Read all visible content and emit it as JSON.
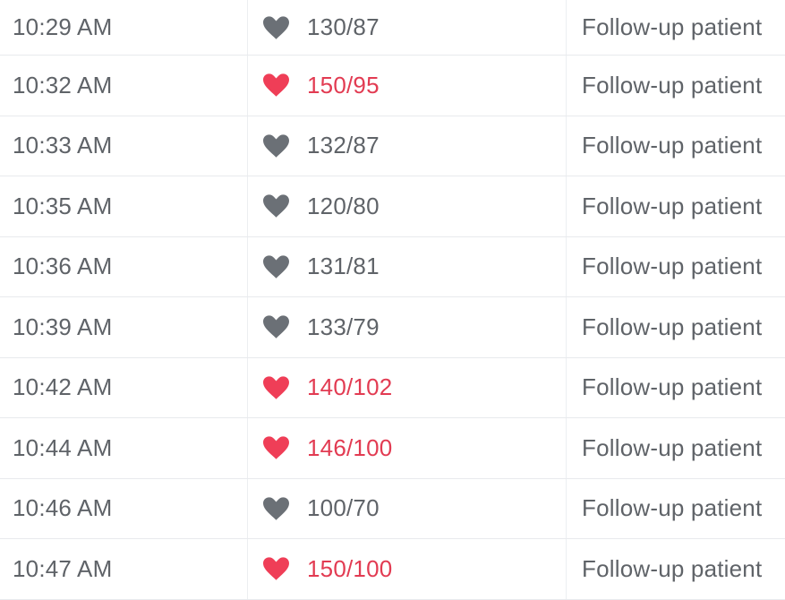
{
  "colors": {
    "text": "#5f6368",
    "alert": "#e23b52",
    "heart_normal": "#6b7076",
    "heart_alert": "#ef3e57",
    "divider": "#e8eaed"
  },
  "rows": [
    {
      "time": "10:29 AM",
      "bp": "130/87",
      "status": "normal",
      "icon": "heart-icon",
      "note": "Follow-up patient"
    },
    {
      "time": "10:32 AM",
      "bp": "150/95",
      "status": "alert",
      "icon": "heart-icon",
      "note": "Follow-up patient"
    },
    {
      "time": "10:33 AM",
      "bp": "132/87",
      "status": "normal",
      "icon": "heart-icon",
      "note": "Follow-up patient"
    },
    {
      "time": "10:35 AM",
      "bp": "120/80",
      "status": "normal",
      "icon": "heart-icon",
      "note": "Follow-up patient"
    },
    {
      "time": "10:36 AM",
      "bp": "131/81",
      "status": "normal",
      "icon": "heart-icon",
      "note": "Follow-up patient"
    },
    {
      "time": "10:39 AM",
      "bp": "133/79",
      "status": "normal",
      "icon": "heart-icon",
      "note": "Follow-up patient"
    },
    {
      "time": "10:42 AM",
      "bp": "140/102",
      "status": "alert",
      "icon": "heart-icon",
      "note": "Follow-up patient"
    },
    {
      "time": "10:44 AM",
      "bp": "146/100",
      "status": "alert",
      "icon": "heart-icon",
      "note": "Follow-up patient"
    },
    {
      "time": "10:46 AM",
      "bp": "100/70",
      "status": "normal",
      "icon": "heart-icon",
      "note": "Follow-up patient"
    },
    {
      "time": "10:47 AM",
      "bp": "150/100",
      "status": "alert",
      "icon": "heart-icon",
      "note": "Follow-up patient"
    }
  ]
}
